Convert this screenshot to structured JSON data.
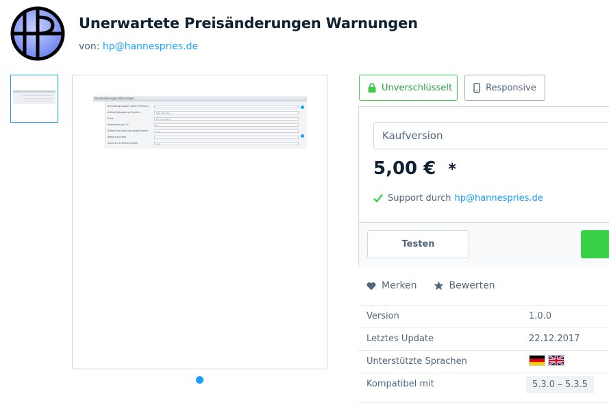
{
  "header": {
    "title": "Unerwartete Preisänderungen Warnungen",
    "byline_prefix": "von:",
    "author_email": "hp@hannespries.de",
    "logo_letters": "HP"
  },
  "preview": {
    "mini_title": "Preisänderungen Warnungen",
    "mini_rows": [
      {
        "label": "Benutzergruppen (keine Prüfung)",
        "value": ""
      },
      {
        "label": "Artikel-Spiegelung Quellen",
        "value": "EK1 (Händler)"
      },
      {
        "label": "Preis",
        "value": "Nicht Ändernd"
      },
      {
        "label": "Abweichung in %",
        "value": "25"
      },
      {
        "label": "Artikel bei Warnung deaktivieren",
        "value": "nein"
      },
      {
        "label": "Warnung Email",
        "value": ""
      },
      {
        "label": "Auch auf 0-Preise prüfen",
        "value": "nein"
      }
    ]
  },
  "badges": {
    "lock_label": "Unverschlüsselt",
    "responsive_label": "Responsive"
  },
  "buy": {
    "version_select": "Kaufversion",
    "price": "5,00 €",
    "price_note": "*",
    "support_label": "Support durch",
    "support_email": "hp@hannespries.de",
    "test_button": "Testen"
  },
  "actions": {
    "remember": "Merken",
    "rate": "Bewerten"
  },
  "specs": {
    "version_label": "Version",
    "version_value": "1.0.0",
    "update_label": "Letztes Update",
    "update_value": "22.12.2017",
    "languages_label": "Unterstützte Sprachen",
    "compat_label": "Kompatibel mit",
    "compat_value": "5.3.0 – 5.3.5"
  },
  "colors": {
    "accent": "#189eff",
    "success": "#37d046",
    "heading": "#0f2233",
    "text": "#52667a"
  },
  "icons": [
    "logo-hp-icon",
    "lock-icon",
    "phone-icon",
    "check-icon",
    "heart-icon",
    "star-icon",
    "flag-de-icon",
    "flag-gb-icon"
  ]
}
